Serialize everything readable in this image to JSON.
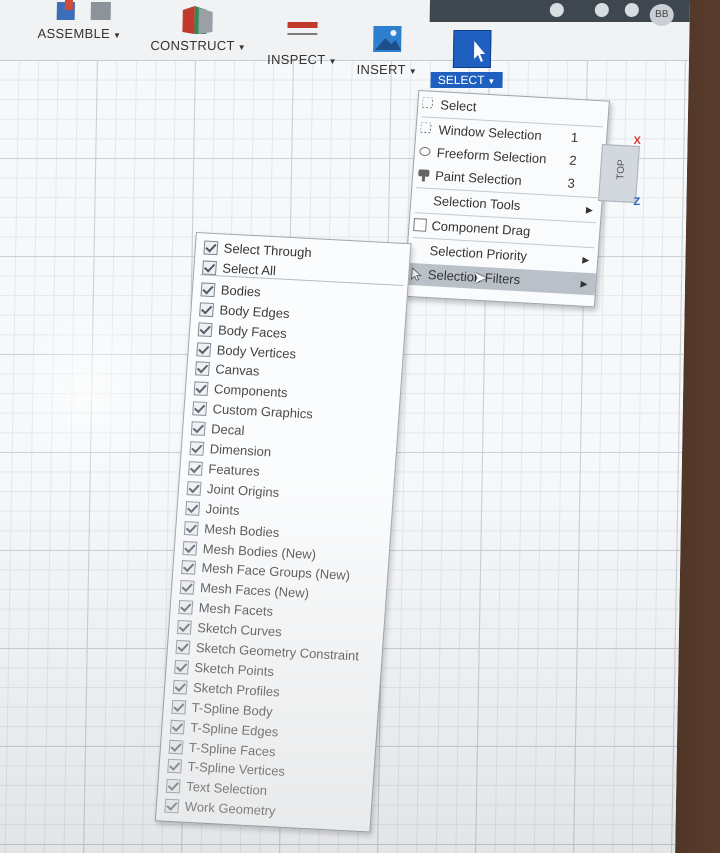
{
  "toolbar": {
    "groups": [
      {
        "label": "ASSEMBLE",
        "icon": "assemble-icon"
      },
      {
        "label": "CONSTRUCT",
        "icon": "construct-icon"
      },
      {
        "label": "INSPECT",
        "icon": "inspect-icon"
      },
      {
        "label": "INSERT",
        "icon": "insert-icon"
      },
      {
        "label": "SELECT",
        "icon": "select-cursor-icon"
      }
    ],
    "avatar_initials": "BB"
  },
  "select_menu": {
    "items": [
      {
        "label": "Select",
        "shortcut": ""
      },
      {
        "label": "Window Selection",
        "shortcut": "1"
      },
      {
        "label": "Freeform Selection",
        "shortcut": "2"
      },
      {
        "label": "Paint Selection",
        "shortcut": "3"
      },
      {
        "label": "Selection Tools",
        "submenu": true
      },
      {
        "label": "Component Drag",
        "checkbox": true,
        "checked": false
      },
      {
        "label": "Selection Priority",
        "submenu": true
      },
      {
        "label": "Selection Filters",
        "submenu": true,
        "highlighted": true
      }
    ]
  },
  "view_cube": {
    "face": "TOP",
    "axis_x": "X",
    "axis_z": "Z"
  },
  "selection_filters": {
    "items": [
      {
        "label": "Select Through",
        "checked": true
      },
      {
        "label": "Select All",
        "checked": true
      },
      {
        "label": "Bodies",
        "checked": true
      },
      {
        "label": "Body Edges",
        "checked": true
      },
      {
        "label": "Body Faces",
        "checked": true
      },
      {
        "label": "Body Vertices",
        "checked": true
      },
      {
        "label": "Canvas",
        "checked": true
      },
      {
        "label": "Components",
        "checked": true
      },
      {
        "label": "Custom Graphics",
        "checked": true
      },
      {
        "label": "Decal",
        "checked": true
      },
      {
        "label": "Dimension",
        "checked": true
      },
      {
        "label": "Features",
        "checked": true
      },
      {
        "label": "Joint Origins",
        "checked": true
      },
      {
        "label": "Joints",
        "checked": true
      },
      {
        "label": "Mesh Bodies",
        "checked": true
      },
      {
        "label": "Mesh Bodies (New)",
        "checked": true
      },
      {
        "label": "Mesh Face Groups (New)",
        "checked": true
      },
      {
        "label": "Mesh Faces (New)",
        "checked": true
      },
      {
        "label": "Mesh Facets",
        "checked": true
      },
      {
        "label": "Sketch Curves",
        "checked": true
      },
      {
        "label": "Sketch Geometry Constraint",
        "checked": true
      },
      {
        "label": "Sketch Points",
        "checked": true
      },
      {
        "label": "Sketch Profiles",
        "checked": true
      },
      {
        "label": "T-Spline Body",
        "checked": true
      },
      {
        "label": "T-Spline Edges",
        "checked": true
      },
      {
        "label": "T-Spline Faces",
        "checked": true
      },
      {
        "label": "T-Spline Vertices",
        "checked": true
      },
      {
        "label": "Text Selection",
        "checked": true
      },
      {
        "label": "Work Geometry",
        "checked": true
      }
    ]
  },
  "colors": {
    "accent": "#1f5fbf",
    "axis_x": "#d23a3a",
    "axis_z": "#2b5fc8"
  }
}
